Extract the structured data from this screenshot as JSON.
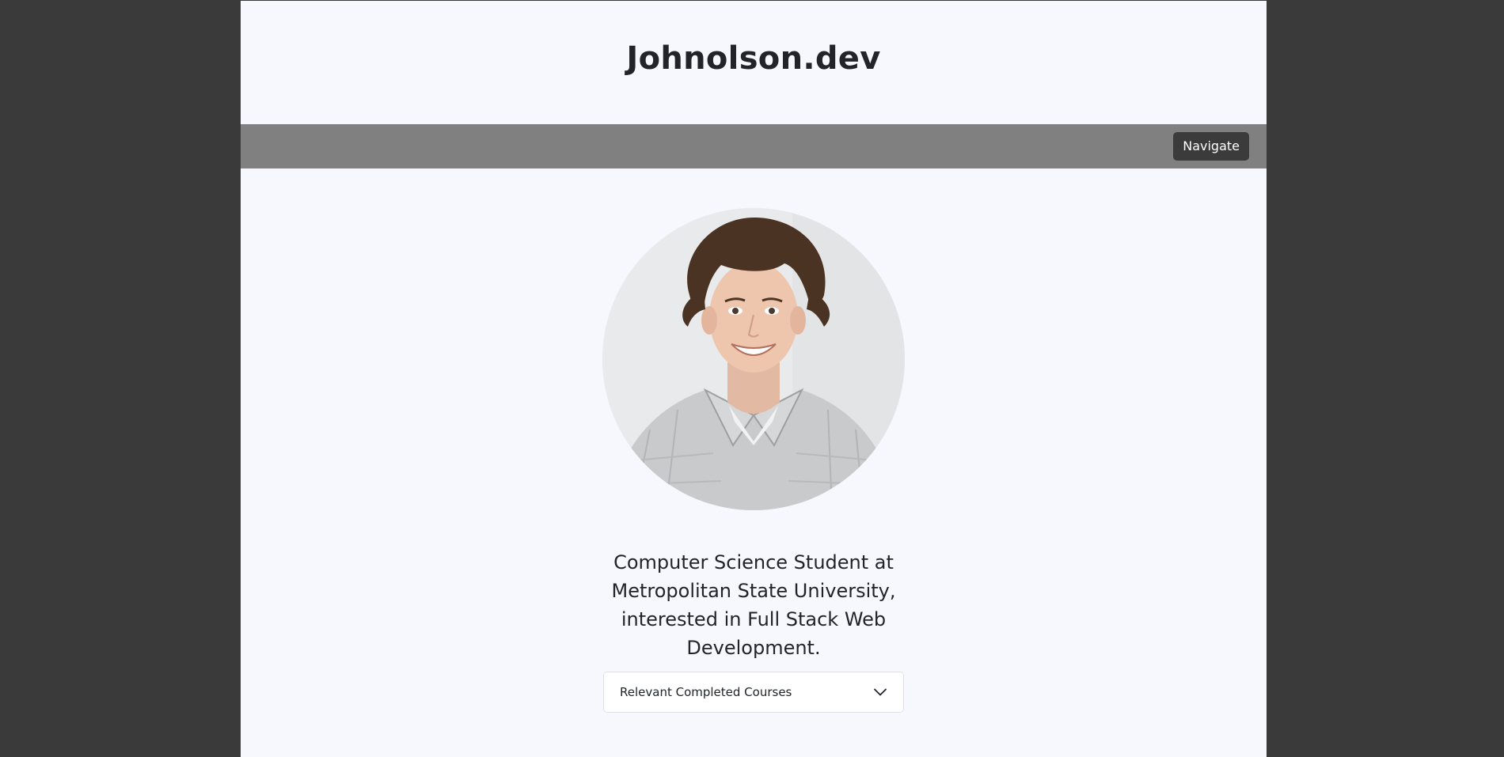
{
  "header": {
    "title": "Johnolson.dev"
  },
  "navbar": {
    "navigate_label": "Navigate"
  },
  "profile": {
    "bio": "Computer Science Student at Metropolitan State University, interested in Full Stack Web Development."
  },
  "courses_accordion": {
    "label": "Relevant Completed Courses",
    "icon": "chevron-down-icon"
  },
  "colors": {
    "backdrop": "#3a3a3a",
    "page_background": "#f7f8fd",
    "navbar_background": "#808080",
    "nav_button_background": "#3b3b3b",
    "text": "#212529"
  }
}
